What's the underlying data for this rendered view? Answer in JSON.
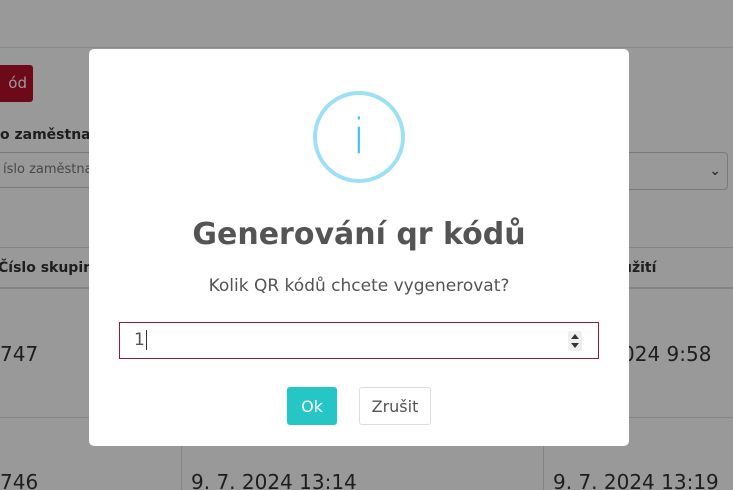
{
  "background": {
    "button_label": "ód",
    "field_label": "o zaměstnance",
    "input_placeholder": "íslo zaměstnance",
    "columns": [
      "Číslo skupiny",
      "užití"
    ],
    "rows": [
      {
        "id": "747",
        "date_right": "024 9:58"
      },
      {
        "id": "746",
        "date_mid": "9. 7. 2024 13:14",
        "date_right": "9. 7. 2024 13:19"
      }
    ]
  },
  "dialog": {
    "title": "Generování qr kódů",
    "message": "Kolik QR kódů chcete vygenerovat?",
    "input_value": "1",
    "ok_label": "Ok",
    "cancel_label": "Zrušit",
    "icon": "info-icon"
  },
  "colors": {
    "accent": "#26c6c6",
    "brand": "#b8102a",
    "info": "#3fc3ee"
  }
}
